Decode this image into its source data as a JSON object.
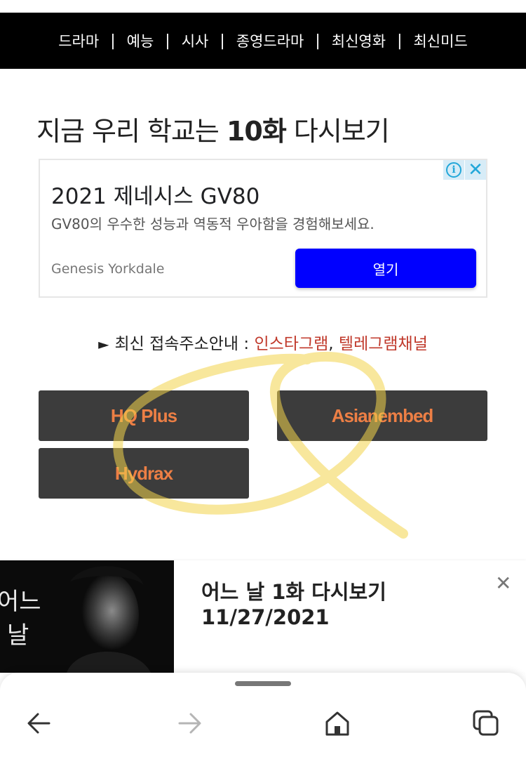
{
  "nav": {
    "items": [
      "드라마",
      "예능",
      "시사",
      "종영드라마",
      "최신영화",
      "최신미드"
    ],
    "separator": "|"
  },
  "title": {
    "show": "지금 우리 학교는",
    "episode": "10화",
    "suffix": "다시보기"
  },
  "ad": {
    "info_icon": "i",
    "close_icon": "✕",
    "headline": "2021 제네시스 GV80",
    "description": "GV80의 우수한 성능과 역동적 우아함을 경험해보세요.",
    "advertiser": "Genesis Yorkdale",
    "open_label": "열기"
  },
  "notice": {
    "arrow": "►",
    "label": "최신 접속주소안내 : ",
    "instagram": "인스타그램",
    "comma": ", ",
    "telegram": "텔레그램채널"
  },
  "servers": [
    "HQ Plus",
    "Asianembed",
    "Hydrax"
  ],
  "recommend": {
    "thumb_text": [
      "어느",
      "날"
    ],
    "title": "어느 날 1화 다시보기",
    "date": "11/27/2021",
    "close_icon": "✕"
  },
  "browser": {
    "icons": [
      "back-arrow-icon",
      "forward-arrow-icon",
      "home-icon",
      "tabs-icon"
    ]
  },
  "colors": {
    "nav_bg": "#000000",
    "ad_button": "#0000ff",
    "link_red": "#c0392b",
    "server_text": "#ed7f45",
    "server_bg": "#3c3c3c",
    "scribble": "#f2d34a"
  }
}
